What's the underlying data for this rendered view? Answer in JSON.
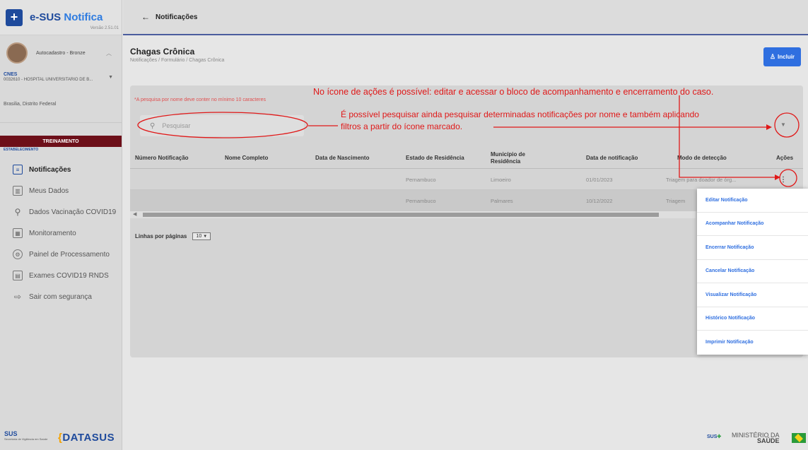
{
  "app": {
    "name_prefix": "e-SUS",
    "name_suffix": "Notifica",
    "version": "Versão 2.51.01"
  },
  "user": {
    "name": "Autocadastro - Bronze"
  },
  "cnes": {
    "label": "CNES",
    "value": "0032610 - HOSPITAL UNIVERSITARIO DE B..."
  },
  "location": "Brasilia, Distrito Federal",
  "environment_badge": "TREINAMENTO",
  "establishment_label": "ESTABELECIMENTO",
  "sidebar": {
    "items": [
      {
        "label": "Notificações",
        "icon": "notification-icon",
        "active": true
      },
      {
        "label": "Meus Dados",
        "icon": "chart-icon"
      },
      {
        "label": "Dados Vacinação COVID19",
        "icon": "vaccine-icon"
      },
      {
        "label": "Monitoramento",
        "icon": "monitor-icon"
      },
      {
        "label": "Painel de Processamento",
        "icon": "gear-icon"
      },
      {
        "label": "Exames COVID19 RNDS",
        "icon": "document-icon"
      },
      {
        "label": "Sair com segurança",
        "icon": "logout-icon"
      }
    ]
  },
  "topbar": {
    "title": "Notificações"
  },
  "page": {
    "title": "Chagas Crônica",
    "breadcrumb": "Notificações / Formulário / Chagas Crônica",
    "include_button": "Incluir"
  },
  "search": {
    "hint": "*A pesquisa por nome deve conter no mínimo 10 caracteres",
    "placeholder": "Pesquisar"
  },
  "table": {
    "headers": [
      "Número Notificação",
      "Nome Completo",
      "Data de Nascimento",
      "Estado de Residência",
      "Município de Residência",
      "Data de notificação",
      "Modo de detecção",
      "Ações"
    ],
    "rows": [
      {
        "numero": "",
        "nome": "",
        "nascimento": "",
        "estado": "Pernambuco",
        "municipio": "Limoeiro",
        "data": "01/01/2023",
        "modo": "Triagem para doador de órg..."
      },
      {
        "numero": "",
        "nome": "",
        "nascimento": "",
        "estado": "Pernambuco",
        "municipio": "Palmares",
        "data": "10/12/2022",
        "modo": "Triagem"
      }
    ]
  },
  "pagination": {
    "label": "Linhas por páginas",
    "value": "10"
  },
  "actions_menu": [
    "Editar Notificação",
    "Acompanhar Notificação",
    "Encerrar Notificação",
    "Cancelar Notificação",
    "Visualizar Notificação",
    "Histórico Notificação",
    "Imprimir Notificação"
  ],
  "annotations": {
    "actions": "No ícone de ações é possível: editar e acessar o bloco de acompanhamento e encerramento do caso.",
    "search_line1": "É possível pesquisar ainda pesquisar determinadas notificações por nome e também aplicando",
    "search_line2": "filtros a partir do ícone marcado."
  },
  "footer": {
    "sus_logo": "SUS",
    "sus_subtitle": "Secretaria de Vigilância em Saúde",
    "datasus": "DATASUS",
    "ministerio_line1": "MINISTÉRIO DA",
    "ministerio_line2": "SAÚDE",
    "sus_mini": "SUS"
  },
  "colors": {
    "brand": "#1e4a9c",
    "accent": "#2f6fe0",
    "annotation": "#e01818",
    "training": "#6d0f19"
  }
}
